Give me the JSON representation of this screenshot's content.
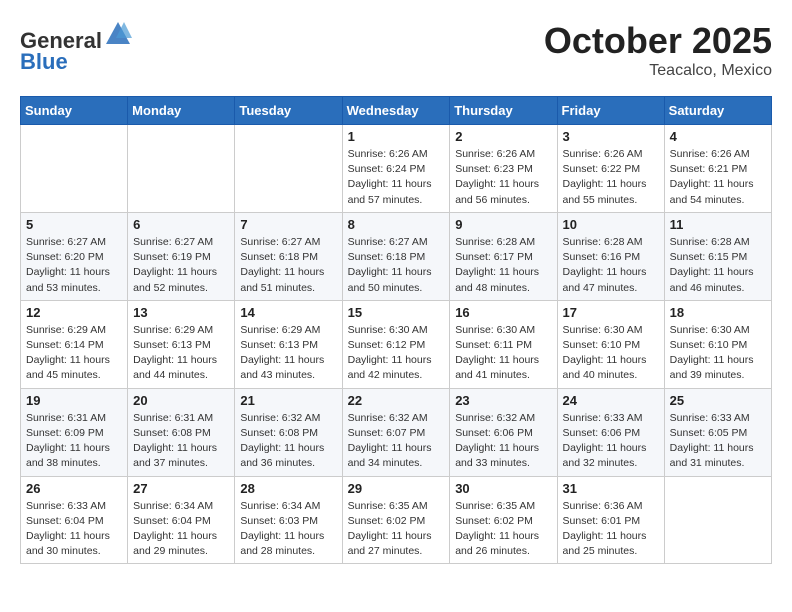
{
  "header": {
    "logo": {
      "line1": "General",
      "line2": "Blue"
    },
    "month": "October 2025",
    "location": "Teacalco, Mexico"
  },
  "weekdays": [
    "Sunday",
    "Monday",
    "Tuesday",
    "Wednesday",
    "Thursday",
    "Friday",
    "Saturday"
  ],
  "weeks": [
    [
      {
        "day": "",
        "info": ""
      },
      {
        "day": "",
        "info": ""
      },
      {
        "day": "",
        "info": ""
      },
      {
        "day": "1",
        "info": "Sunrise: 6:26 AM\nSunset: 6:24 PM\nDaylight: 11 hours and 57 minutes."
      },
      {
        "day": "2",
        "info": "Sunrise: 6:26 AM\nSunset: 6:23 PM\nDaylight: 11 hours and 56 minutes."
      },
      {
        "day": "3",
        "info": "Sunrise: 6:26 AM\nSunset: 6:22 PM\nDaylight: 11 hours and 55 minutes."
      },
      {
        "day": "4",
        "info": "Sunrise: 6:26 AM\nSunset: 6:21 PM\nDaylight: 11 hours and 54 minutes."
      }
    ],
    [
      {
        "day": "5",
        "info": "Sunrise: 6:27 AM\nSunset: 6:20 PM\nDaylight: 11 hours and 53 minutes."
      },
      {
        "day": "6",
        "info": "Sunrise: 6:27 AM\nSunset: 6:19 PM\nDaylight: 11 hours and 52 minutes."
      },
      {
        "day": "7",
        "info": "Sunrise: 6:27 AM\nSunset: 6:18 PM\nDaylight: 11 hours and 51 minutes."
      },
      {
        "day": "8",
        "info": "Sunrise: 6:27 AM\nSunset: 6:18 PM\nDaylight: 11 hours and 50 minutes."
      },
      {
        "day": "9",
        "info": "Sunrise: 6:28 AM\nSunset: 6:17 PM\nDaylight: 11 hours and 48 minutes."
      },
      {
        "day": "10",
        "info": "Sunrise: 6:28 AM\nSunset: 6:16 PM\nDaylight: 11 hours and 47 minutes."
      },
      {
        "day": "11",
        "info": "Sunrise: 6:28 AM\nSunset: 6:15 PM\nDaylight: 11 hours and 46 minutes."
      }
    ],
    [
      {
        "day": "12",
        "info": "Sunrise: 6:29 AM\nSunset: 6:14 PM\nDaylight: 11 hours and 45 minutes."
      },
      {
        "day": "13",
        "info": "Sunrise: 6:29 AM\nSunset: 6:13 PM\nDaylight: 11 hours and 44 minutes."
      },
      {
        "day": "14",
        "info": "Sunrise: 6:29 AM\nSunset: 6:13 PM\nDaylight: 11 hours and 43 minutes."
      },
      {
        "day": "15",
        "info": "Sunrise: 6:30 AM\nSunset: 6:12 PM\nDaylight: 11 hours and 42 minutes."
      },
      {
        "day": "16",
        "info": "Sunrise: 6:30 AM\nSunset: 6:11 PM\nDaylight: 11 hours and 41 minutes."
      },
      {
        "day": "17",
        "info": "Sunrise: 6:30 AM\nSunset: 6:10 PM\nDaylight: 11 hours and 40 minutes."
      },
      {
        "day": "18",
        "info": "Sunrise: 6:30 AM\nSunset: 6:10 PM\nDaylight: 11 hours and 39 minutes."
      }
    ],
    [
      {
        "day": "19",
        "info": "Sunrise: 6:31 AM\nSunset: 6:09 PM\nDaylight: 11 hours and 38 minutes."
      },
      {
        "day": "20",
        "info": "Sunrise: 6:31 AM\nSunset: 6:08 PM\nDaylight: 11 hours and 37 minutes."
      },
      {
        "day": "21",
        "info": "Sunrise: 6:32 AM\nSunset: 6:08 PM\nDaylight: 11 hours and 36 minutes."
      },
      {
        "day": "22",
        "info": "Sunrise: 6:32 AM\nSunset: 6:07 PM\nDaylight: 11 hours and 34 minutes."
      },
      {
        "day": "23",
        "info": "Sunrise: 6:32 AM\nSunset: 6:06 PM\nDaylight: 11 hours and 33 minutes."
      },
      {
        "day": "24",
        "info": "Sunrise: 6:33 AM\nSunset: 6:06 PM\nDaylight: 11 hours and 32 minutes."
      },
      {
        "day": "25",
        "info": "Sunrise: 6:33 AM\nSunset: 6:05 PM\nDaylight: 11 hours and 31 minutes."
      }
    ],
    [
      {
        "day": "26",
        "info": "Sunrise: 6:33 AM\nSunset: 6:04 PM\nDaylight: 11 hours and 30 minutes."
      },
      {
        "day": "27",
        "info": "Sunrise: 6:34 AM\nSunset: 6:04 PM\nDaylight: 11 hours and 29 minutes."
      },
      {
        "day": "28",
        "info": "Sunrise: 6:34 AM\nSunset: 6:03 PM\nDaylight: 11 hours and 28 minutes."
      },
      {
        "day": "29",
        "info": "Sunrise: 6:35 AM\nSunset: 6:02 PM\nDaylight: 11 hours and 27 minutes."
      },
      {
        "day": "30",
        "info": "Sunrise: 6:35 AM\nSunset: 6:02 PM\nDaylight: 11 hours and 26 minutes."
      },
      {
        "day": "31",
        "info": "Sunrise: 6:36 AM\nSunset: 6:01 PM\nDaylight: 11 hours and 25 minutes."
      },
      {
        "day": "",
        "info": ""
      }
    ]
  ]
}
